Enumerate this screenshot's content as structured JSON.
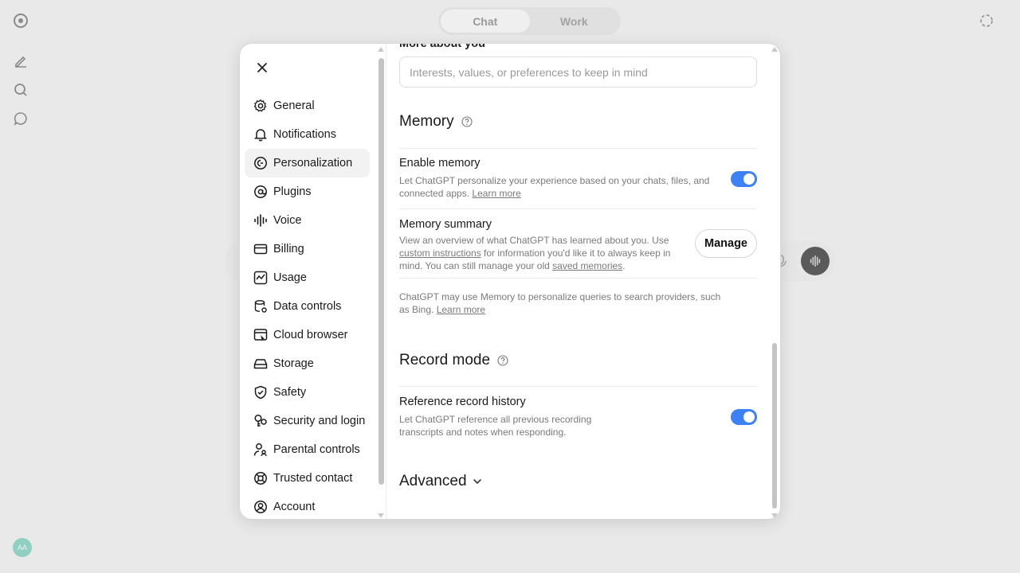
{
  "background": {
    "tabs": [
      {
        "label": "Chat"
      },
      {
        "label": "Work"
      }
    ],
    "avatar_initials": "AA"
  },
  "nav": {
    "items": [
      {
        "label": "General",
        "icon": "gear-icon"
      },
      {
        "label": "Notifications",
        "icon": "bell-icon"
      },
      {
        "label": "Personalization",
        "icon": "personalization-icon",
        "active": true
      },
      {
        "label": "Plugins",
        "icon": "at-sign-icon"
      },
      {
        "label": "Voice",
        "icon": "waveform-icon"
      },
      {
        "label": "Billing",
        "icon": "credit-card-icon"
      },
      {
        "label": "Usage",
        "icon": "chart-icon"
      },
      {
        "label": "Data controls",
        "icon": "database-icon"
      },
      {
        "label": "Cloud browser",
        "icon": "browser-icon"
      },
      {
        "label": "Storage",
        "icon": "storage-icon"
      },
      {
        "label": "Safety",
        "icon": "shield-icon"
      },
      {
        "label": "Security and login",
        "icon": "key-icon"
      },
      {
        "label": "Parental controls",
        "icon": "parent-icon"
      },
      {
        "label": "Trusted contact",
        "icon": "lifebuoy-icon"
      },
      {
        "label": "Account",
        "icon": "account-icon"
      }
    ]
  },
  "content": {
    "more_about_heading": "More about you",
    "more_about_placeholder": "Interests, values, or preferences to keep in mind",
    "memory": {
      "title": "Memory",
      "enable_title": "Enable memory",
      "enable_desc_line1": "Let ChatGPT personalize your experience based on your chats, files, and",
      "enable_desc_line2": "connected apps.",
      "learn_more": "Learn more",
      "enable_on": true,
      "summary_title": "Memory summary",
      "summary_line1": "View an overview of what ChatGPT has learned about you. Use",
      "summary_link1": "custom instructions",
      "summary_line2": "for information you'd like it to always keep in",
      "summary_line3": "mind. You can still manage your old",
      "summary_link2": "saved memories",
      "summary_end": ".",
      "manage_label": "Manage",
      "note_line1": "ChatGPT may use Memory to personalize queries to search providers, such",
      "note_line2": "as Bing.",
      "note_learn_more": "Learn more"
    },
    "record": {
      "title": "Record mode",
      "ref_title": "Reference record history",
      "ref_desc_line1": "Let ChatGPT reference all previous recording",
      "ref_desc_line2": "transcripts and notes when responding.",
      "ref_on": true
    },
    "advanced_label": "Advanced"
  },
  "colors": {
    "toggle_on": "#3c82f6",
    "backdrop": "#e9e9e9"
  }
}
